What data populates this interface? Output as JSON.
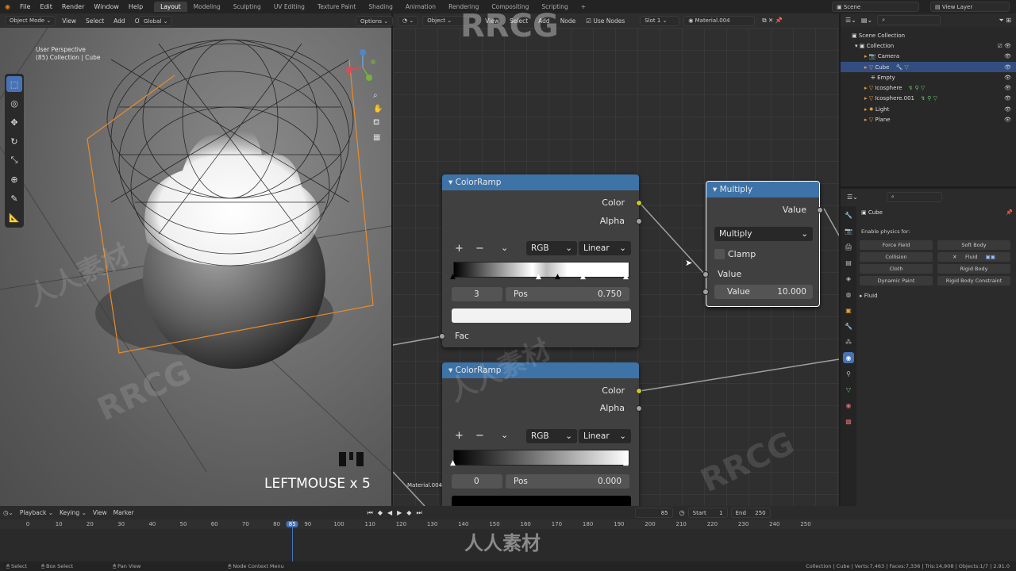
{
  "menus": [
    "File",
    "Edit",
    "Render",
    "Window",
    "Help"
  ],
  "workspaces": [
    "Layout",
    "Modeling",
    "Sculpting",
    "UV Editing",
    "Texture Paint",
    "Shading",
    "Animation",
    "Rendering",
    "Compositing",
    "Scripting"
  ],
  "active_workspace": "Layout",
  "topbar": {
    "orientation": "Global",
    "options": "Options",
    "scene": "Scene",
    "view_layer": "View Layer"
  },
  "viewport": {
    "mode": "Object Mode",
    "menus": [
      "View",
      "Select",
      "Add",
      "Object"
    ],
    "info_line1": "User Perspective",
    "info_line2": "(85) Collection | Cube",
    "key_overlay": "LEFTMOUSE x 5"
  },
  "node_editor": {
    "type_label": "Object",
    "menus": [
      "View",
      "Select",
      "Add",
      "Node"
    ],
    "use_nodes": "Use Nodes",
    "slot": "Slot 1",
    "material": "Material.004",
    "frame_label": "Material.004"
  },
  "nodes": {
    "colorramp1": {
      "title": "ColorRamp",
      "out_color": "Color",
      "out_alpha": "Alpha",
      "color_mode": "RGB",
      "interp": "Linear",
      "index": "3",
      "pos_label": "Pos",
      "pos_value": "0.750",
      "in_fac": "Fac",
      "add": "+",
      "remove": "−",
      "menu": "⌄"
    },
    "colorramp2": {
      "title": "ColorRamp",
      "out_color": "Color",
      "out_alpha": "Alpha",
      "color_mode": "RGB",
      "interp": "Linear",
      "index": "0",
      "pos_label": "Pos",
      "pos_value": "0.000",
      "add": "+",
      "remove": "−",
      "menu": "⌄"
    },
    "multiply": {
      "title": "Multiply",
      "out_value": "Value",
      "operation": "Multiply",
      "clamp": "Clamp",
      "in_value": "Value",
      "value_label": "Value",
      "value": "10.000"
    }
  },
  "outliner": {
    "root": "Scene Collection",
    "items": [
      {
        "label": "Collection",
        "level": 1,
        "selected": false
      },
      {
        "label": "Camera",
        "level": 2,
        "selected": false
      },
      {
        "label": "Cube",
        "level": 2,
        "selected": true
      },
      {
        "label": "Empty",
        "level": 2,
        "selected": false
      },
      {
        "label": "Icosphere",
        "level": 2,
        "selected": false
      },
      {
        "label": "Icosphere.001",
        "level": 2,
        "selected": false
      },
      {
        "label": "Light",
        "level": 2,
        "selected": false
      },
      {
        "label": "Plane",
        "level": 2,
        "selected": false
      }
    ]
  },
  "properties": {
    "object": "Cube",
    "enable_physics": "Enable physics for:",
    "buttons": [
      "Force Field",
      "Soft Body",
      "Collision",
      "Fluid",
      "Cloth",
      "Rigid Body",
      "Dynamic Paint",
      "Rigid Body Constraint"
    ],
    "fluid_panel": "Fluid"
  },
  "timeline": {
    "menus": [
      "Playback",
      "Keying",
      "View",
      "Marker"
    ],
    "current_frame": "85",
    "start_label": "Start",
    "start": "1",
    "end_label": "End",
    "end": "250",
    "ticks": [
      "0",
      "10",
      "20",
      "30",
      "40",
      "50",
      "60",
      "70",
      "80",
      "85",
      "90",
      "100",
      "110",
      "120",
      "130",
      "140",
      "150",
      "160",
      "170",
      "180",
      "190",
      "200",
      "210",
      "220",
      "230",
      "240",
      "250"
    ]
  },
  "status": {
    "select": "Select",
    "box_select": "Box Select",
    "pan_view": "Pan View",
    "context": "Node Context Menu",
    "stats": "Collection | Cube | Verts:7,463 | Faces:7,336 | Tris:14,908 | Objects:1/7 | 2.91.0"
  },
  "watermarks": [
    "RRCG",
    "人人素材"
  ],
  "colors": {
    "accent": "#4772b3",
    "node_header": "#3e73a8",
    "socket_yellow": "#c7c729",
    "selection": "#334d80"
  }
}
